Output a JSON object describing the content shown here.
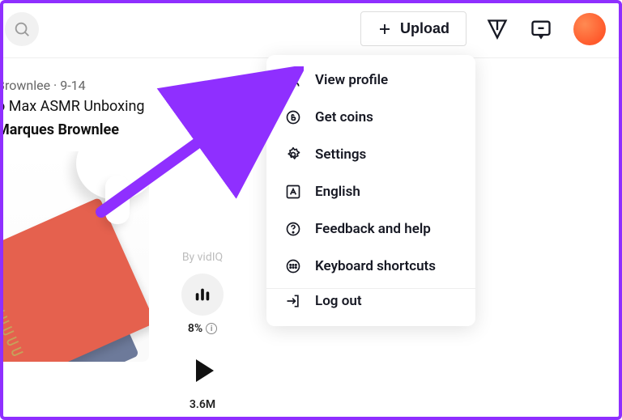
{
  "header": {
    "upload_label": "Upload"
  },
  "feed": {
    "meta": "Brownlee · 9-14",
    "title": "o Max ASMR Unboxing",
    "author": "Marques Brownlee"
  },
  "stats": {
    "byline": "By vidIQ",
    "engagement_pct": "8%",
    "play_count": "3.6M"
  },
  "menu": {
    "view_profile": "View profile",
    "get_coins": "Get coins",
    "settings": "Settings",
    "language": "English",
    "feedback": "Feedback and help",
    "shortcuts": "Keyboard shortcuts",
    "logout": "Log out"
  }
}
